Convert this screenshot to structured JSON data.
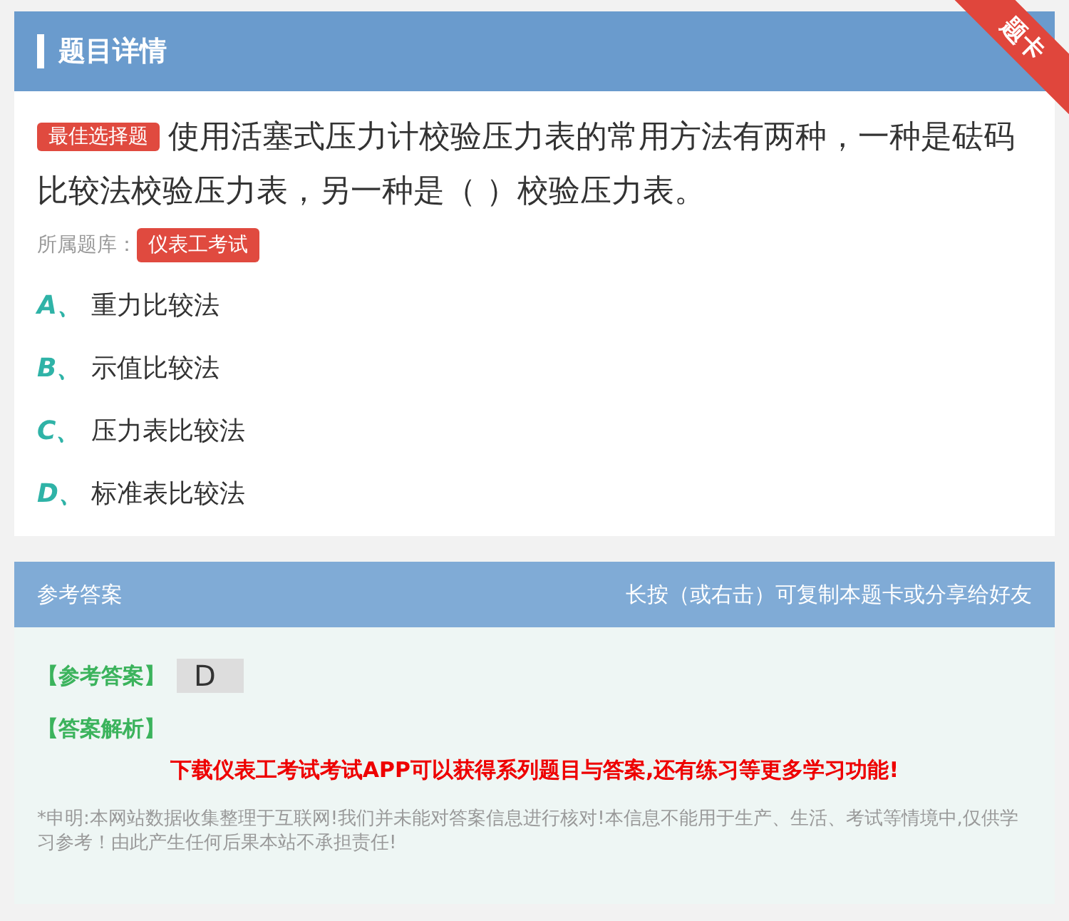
{
  "header": {
    "title": "题目详情",
    "ribbon": "题卡"
  },
  "question": {
    "type_tag": "最佳选择题",
    "text": "使用活塞式压力计校验压力表的常用方法有两种，一种是砝码比较法校验压力表，另一种是（ ）校验压力表。",
    "bank_label": "所属题库：",
    "bank_tag": "仪表工考试"
  },
  "options": [
    {
      "letter": "A、",
      "text": "重力比较法"
    },
    {
      "letter": "B、",
      "text": "示值比较法"
    },
    {
      "letter": "C、",
      "text": "压力表比较法"
    },
    {
      "letter": "D、",
      "text": "标准表比较法"
    }
  ],
  "answer_panel": {
    "title": "参考答案",
    "hint": "长按（或右击）可复制本题卡或分享给好友",
    "answer_label": "【参考答案】",
    "answer": "D",
    "analysis_label": "【答案解析】",
    "promo": "下载仪表工考试考试APP可以获得系列题目与答案,还有练习等更多学习功能!",
    "disclaimer": "*申明:本网站数据收集整理于互联网!我们并未能对答案信息进行核对!本信息不能用于生产、生活、考试等情境中,仅供学习参考！由此产生任何后果本站不承担责任!"
  }
}
